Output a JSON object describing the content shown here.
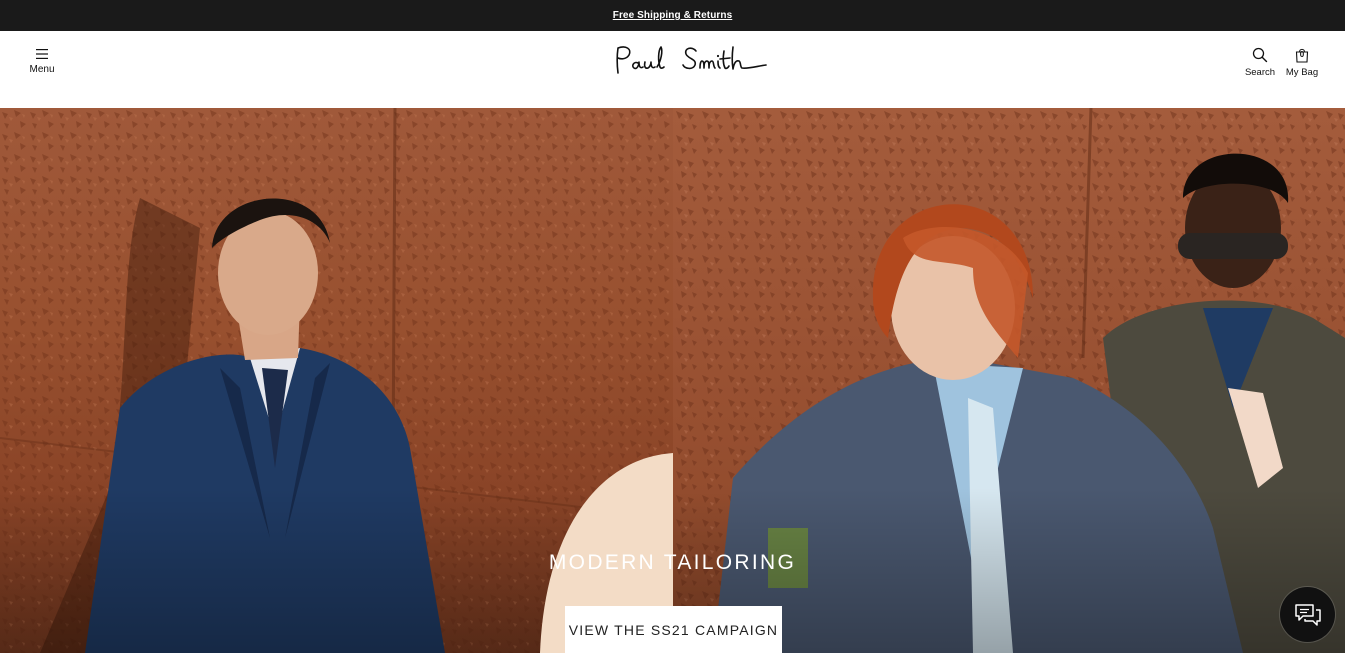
{
  "promo": {
    "text": "Free Shipping & Returns"
  },
  "header": {
    "menu_label": "Menu",
    "logo_text": "Paul Smith",
    "search_label": "Search",
    "bag_label": "My Bag",
    "bag_count": "0"
  },
  "hero": {
    "title": "MODERN TAILORING",
    "cta_label": "VIEW THE SS21 CAMPAIGN"
  },
  "icons": {
    "menu": "hamburger-icon",
    "search": "search-icon",
    "bag": "shopping-bag-icon",
    "chat": "chat-icon"
  },
  "colors": {
    "promo_bg": "#1a1a1a",
    "hero_wall": "#9a5233",
    "suit_navy": "#1f3a63",
    "chat_bg": "#111111"
  }
}
